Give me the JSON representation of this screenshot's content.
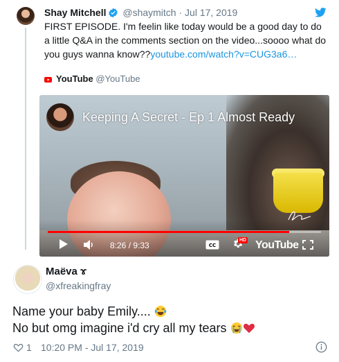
{
  "parent_tweet": {
    "author_name": "Shay Mitchell",
    "handle": "@shaymitch",
    "separator": "·",
    "date": "Jul 17, 2019",
    "text": "FIRST EPISODE. I'm feelin like today would be a good day to do a little Q&A in the comments section on the video...soooo what do you guys wanna know??",
    "link": "youtube.com/watch?v=CUG3a6…"
  },
  "youtube_card": {
    "source_name": "YouTube",
    "source_handle": "@YouTube",
    "video_title": "Keeping A Secret - Ep 1 Almost Ready",
    "time_display": "8:26 / 9:33",
    "progress": 0.883,
    "hd_label": "HD",
    "cc_label": "CC",
    "brand_text": "YouTube"
  },
  "reply_tweet": {
    "author_name": "Maëva ɤ",
    "handle": "@xfreakingfray",
    "line1": "Name your baby Emily....",
    "line2": "No but omg imagine i'd cry all my tears",
    "like_count": "1",
    "timestamp": "10:20 PM - Jul 17, 2019"
  },
  "icons": {
    "verified": "verified-badge-icon",
    "bird": "twitter-bird-icon",
    "heart": "heart-icon",
    "info": "info-icon"
  },
  "colors": {
    "twitter_blue": "#1da1f2",
    "link_blue": "#1b95e0",
    "youtube_red": "#ff0000",
    "muted_gray": "#657786"
  }
}
